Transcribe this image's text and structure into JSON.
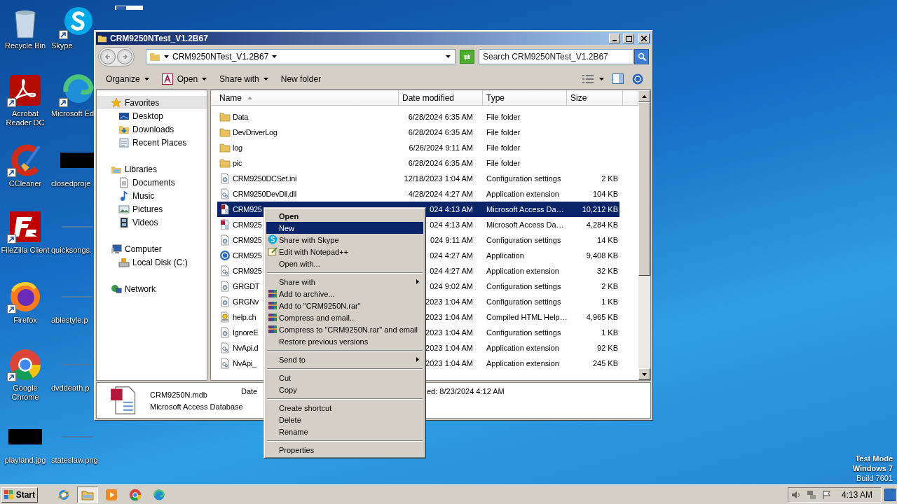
{
  "desktop": {
    "icons": [
      {
        "label": "Recycle Bin",
        "kind": "recycle-bin",
        "shortcut": false
      },
      {
        "label": "Skype",
        "kind": "skype",
        "shortcut": true
      },
      {
        "label": "Acrobat Reader DC",
        "kind": "acrobat",
        "shortcut": true
      },
      {
        "label": "Microsoft Ed",
        "kind": "edge",
        "shortcut": true
      },
      {
        "label": "CCleaner",
        "kind": "ccleaner",
        "shortcut": true
      },
      {
        "label": "closedproje",
        "kind": "redacted",
        "shortcut": false
      },
      {
        "label": "FileZilla Client",
        "kind": "filezilla",
        "shortcut": true
      },
      {
        "label": "quicksongs.",
        "kind": "blank",
        "shortcut": false
      },
      {
        "label": "Firefox",
        "kind": "firefox",
        "shortcut": true
      },
      {
        "label": "ablestyle.p",
        "kind": "blank",
        "shortcut": false
      },
      {
        "label": "Google Chrome",
        "kind": "chrome",
        "shortcut": true
      },
      {
        "label": "dvddeath.p",
        "kind": "blank",
        "shortcut": false
      },
      {
        "label": "playland.jpg",
        "kind": "redacted",
        "shortcut": false
      },
      {
        "label": "stateslaw.png",
        "kind": "blank",
        "shortcut": false
      }
    ],
    "build_info": [
      "Test Mode",
      "Windows 7",
      "Build 7601"
    ]
  },
  "window": {
    "title": "CRM9250NTest_V1.2B67",
    "address": {
      "path": "CRM9250NTest_V1.2B67"
    },
    "search": {
      "placeholder": "Search CRM9250NTest_V1.2B67"
    },
    "toolbar": [
      {
        "label": "Organize",
        "kind": "plain",
        "dropdown": true
      },
      {
        "label": "Open",
        "kind": "app",
        "dropdown": true
      },
      {
        "label": "Share with",
        "kind": "plain",
        "dropdown": true
      },
      {
        "label": "New folder",
        "kind": "plain",
        "dropdown": false
      }
    ],
    "nav": [
      {
        "label": "Favorites",
        "kind": "star",
        "selected": true,
        "children": [
          {
            "label": "Desktop",
            "kind": "desktop",
            "selected": false
          },
          {
            "label": "Downloads",
            "kind": "downloads",
            "selected": false
          },
          {
            "label": "Recent Places",
            "kind": "recent",
            "selected": false
          }
        ]
      },
      {
        "label": "Libraries",
        "kind": "libraries",
        "selected": false,
        "children": [
          {
            "label": "Documents",
            "kind": "documents",
            "selected": false
          },
          {
            "label": "Music",
            "kind": "music",
            "selected": false
          },
          {
            "label": "Pictures",
            "kind": "pictures",
            "selected": false
          },
          {
            "label": "Videos",
            "kind": "videos",
            "selected": false
          }
        ]
      },
      {
        "label": "Computer",
        "kind": "computer",
        "selected": false,
        "children": [
          {
            "label": "Local Disk (C:)",
            "kind": "disk",
            "selected": false
          }
        ]
      },
      {
        "label": "Network",
        "kind": "network",
        "selected": false
      }
    ],
    "columns": [
      {
        "label": "Name",
        "sorted": true
      },
      {
        "label": "Date modified",
        "sorted": false
      },
      {
        "label": "Type",
        "sorted": false
      },
      {
        "label": "Size",
        "sorted": false
      }
    ],
    "rows": [
      {
        "name": "Data",
        "date": "6/28/2024 6:35 AM",
        "type": "File folder",
        "kind": "folder",
        "selected": false
      },
      {
        "name": "DevDriverLog",
        "date": "6/28/2024 6:35 AM",
        "type": "File folder",
        "kind": "folder",
        "selected": false
      },
      {
        "name": "log",
        "date": "6/26/2024 9:11 AM",
        "type": "File folder",
        "kind": "folder",
        "selected": false
      },
      {
        "name": "pic",
        "date": "6/28/2024 6:35 AM",
        "type": "File folder",
        "kind": "folder",
        "selected": false
      },
      {
        "name": "CRM9250DCSet.ini",
        "date": "12/18/2023 1:04 AM",
        "type": "Configuration settings",
        "size": "2 KB",
        "kind": "settings",
        "selected": false
      },
      {
        "name": "CRM9250DevDll.dll",
        "date": "4/28/2024 4:27 AM",
        "type": "Application extension",
        "size": "104 KB",
        "kind": "extension",
        "selected": false
      },
      {
        "name": "CRM925",
        "date": "024 4:13 AM",
        "type": "Microsoft Access Da…",
        "size": "10,212 KB",
        "kind": "database",
        "selected": true
      },
      {
        "name": "CRM925",
        "date": "024 4:13 AM",
        "type": "Microsoft Access Da…",
        "size": "4,284 KB",
        "kind": "database",
        "selected": false
      },
      {
        "name": "CRM925",
        "date": "024 9:11 AM",
        "type": "Configuration settings",
        "size": "14 KB",
        "kind": "settings",
        "selected": false
      },
      {
        "name": "CRM925",
        "date": "024 4:27 AM",
        "type": "Application",
        "size": "9,408 KB",
        "kind": "app",
        "selected": false
      },
      {
        "name": "CRM925",
        "date": "024 4:27 AM",
        "type": "Application extension",
        "size": "32 KB",
        "kind": "extension",
        "selected": false
      },
      {
        "name": "GRGDT",
        "date": "024 9:02 AM",
        "type": "Configuration settings",
        "size": "2 KB",
        "kind": "settings",
        "selected": false
      },
      {
        "name": "GRGNv",
        "date": "2023 1:04 AM",
        "type": "Configuration settings",
        "size": "1 KB",
        "kind": "settings",
        "selected": false
      },
      {
        "name": "help.ch",
        "date": "2023 1:04 AM",
        "type": "Compiled HTML Help…",
        "size": "4,965 KB",
        "kind": "help",
        "selected": false
      },
      {
        "name": "IgnoreE",
        "date": "2023 1:04 AM",
        "type": "Configuration settings",
        "size": "1 KB",
        "kind": "settings",
        "selected": false
      },
      {
        "name": "NvApi.d",
        "date": "2023 1:04 AM",
        "type": "Application extension",
        "size": "92 KB",
        "kind": "extension",
        "selected": false
      },
      {
        "name": "NvApi_",
        "date": "2023 1:04 AM",
        "type": "Application extension",
        "size": "245 KB",
        "kind": "extension",
        "selected": false
      }
    ],
    "details": {
      "name": "CRM9250N.mdb",
      "type": "Microsoft Access Database",
      "date_label": "Date",
      "date_value": "ed: 8/23/2024 4:12 AM"
    }
  },
  "context_menu": {
    "items": [
      {
        "kind": "plain",
        "label": "Open",
        "default": true,
        "selected": false,
        "submenu": false
      },
      {
        "kind": "plain",
        "label": "New",
        "default": false,
        "selected": true,
        "submenu": false
      },
      {
        "kind": "skype",
        "label": "Share with Skype",
        "default": false,
        "selected": false,
        "submenu": false
      },
      {
        "kind": "notepad",
        "label": "Edit with Notepad++",
        "default": false,
        "selected": false,
        "submenu": false
      },
      {
        "kind": "plain",
        "label": "Open with...",
        "default": false,
        "selected": false,
        "submenu": false
      },
      {
        "kind": "separator"
      },
      {
        "kind": "plain",
        "label": "Share with",
        "default": false,
        "selected": false,
        "submenu": true
      },
      {
        "kind": "archive",
        "label": "Add to archive...",
        "default": false,
        "selected": false,
        "submenu": false
      },
      {
        "kind": "archive",
        "label": "Add to \"CRM9250N.rar\"",
        "default": false,
        "selected": false,
        "submenu": false
      },
      {
        "kind": "archive",
        "label": "Compress and email...",
        "default": false,
        "selected": false,
        "submenu": false
      },
      {
        "kind": "archive",
        "label": "Compress to \"CRM9250N.rar\" and email",
        "default": false,
        "selected": false,
        "submenu": false
      },
      {
        "kind": "plain",
        "label": "Restore previous versions",
        "default": false,
        "selected": false,
        "submenu": false
      },
      {
        "kind": "separator"
      },
      {
        "kind": "plain",
        "label": "Send to",
        "default": false,
        "selected": false,
        "submenu": true
      },
      {
        "kind": "separator"
      },
      {
        "kind": "plain",
        "label": "Cut",
        "default": false,
        "selected": false,
        "submenu": false
      },
      {
        "kind": "plain",
        "label": "Copy",
        "default": false,
        "selected": false,
        "submenu": false
      },
      {
        "kind": "separator"
      },
      {
        "kind": "plain",
        "label": "Create shortcut",
        "default": false,
        "selected": false,
        "submenu": false
      },
      {
        "kind": "plain",
        "label": "Delete",
        "default": false,
        "selected": false,
        "submenu": false
      },
      {
        "kind": "plain",
        "label": "Rename",
        "default": false,
        "selected": false,
        "submenu": false
      },
      {
        "kind": "separator"
      },
      {
        "kind": "plain",
        "label": "Properties",
        "default": false,
        "selected": false,
        "submenu": false
      }
    ]
  },
  "taskbar": {
    "start": "Start",
    "apps": [
      {
        "kind": "ie",
        "active": false
      },
      {
        "kind": "explorer",
        "active": true
      },
      {
        "kind": "media",
        "active": false
      },
      {
        "kind": "chrome",
        "active": false
      },
      {
        "kind": "edge",
        "active": false
      }
    ],
    "clock": "4:13 AM"
  }
}
